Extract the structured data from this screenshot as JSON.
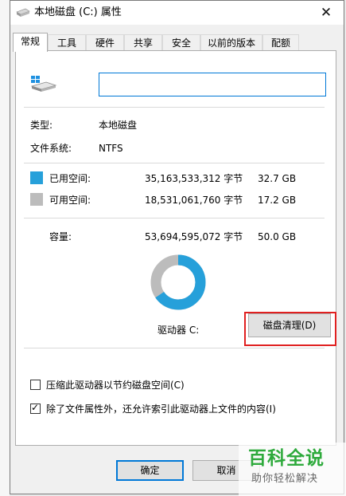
{
  "window": {
    "title": "本地磁盘 (C:) 属性",
    "close_glyph": "✕"
  },
  "tabs": [
    {
      "label": "常规",
      "active": true
    },
    {
      "label": "工具",
      "active": false
    },
    {
      "label": "硬件",
      "active": false
    },
    {
      "label": "共享",
      "active": false
    },
    {
      "label": "安全",
      "active": false
    },
    {
      "label": "以前的版本",
      "active": false
    },
    {
      "label": "配额",
      "active": false
    }
  ],
  "general": {
    "name_value": "",
    "type_label": "类型:",
    "type_value": "本地磁盘",
    "fs_label": "文件系统:",
    "fs_value": "NTFS",
    "used": {
      "label": "已用空间:",
      "bytes": "35,163,533,312 字节",
      "size": "32.7 GB",
      "color": "#26a0da"
    },
    "free": {
      "label": "可用空间:",
      "bytes": "18,531,061,760 字节",
      "size": "17.2 GB",
      "color": "#bcbcbc"
    },
    "capacity": {
      "label": "容量:",
      "bytes": "53,694,595,072 字节",
      "size": "50.0 GB"
    },
    "used_fraction": 0.655,
    "drive_label": "驱动器 C:",
    "cleanup_label": "磁盘清理(D)",
    "compress": {
      "label": "压缩此驱动器以节约磁盘空间(C)",
      "checked": false
    },
    "index": {
      "label": "除了文件属性外，还允许索引此驱动器上文件的内容(I)",
      "checked": true,
      "mark": "✓"
    }
  },
  "buttons": {
    "ok": "确定",
    "cancel": "取消"
  },
  "watermark": {
    "main": "百科全说",
    "sub": "助你轻松解决"
  }
}
